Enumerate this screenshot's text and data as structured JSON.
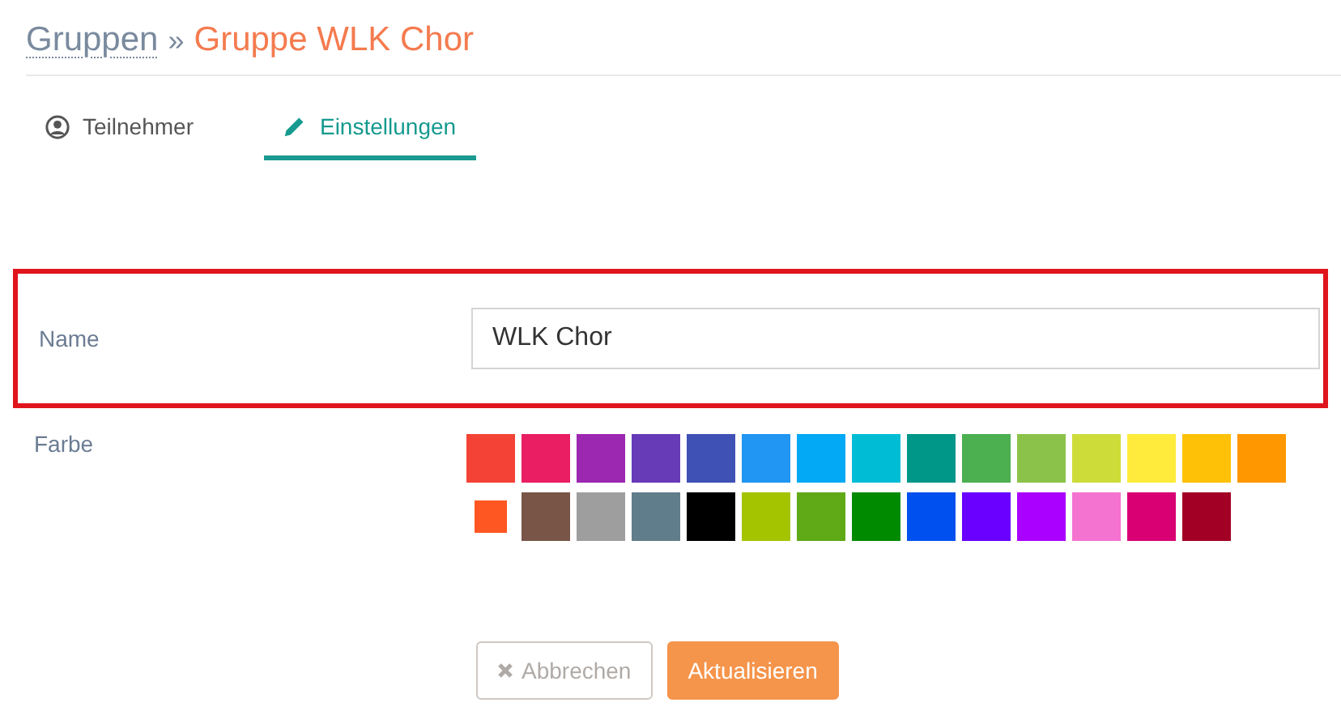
{
  "breadcrumb": {
    "parent": "Gruppen",
    "separator": "»",
    "current": "Gruppe WLK Chor"
  },
  "tabs": [
    {
      "label": "Teilnehmer",
      "kind": "participants",
      "selected": false
    },
    {
      "label": "Einstellungen",
      "kind": "settings",
      "selected": true
    }
  ],
  "form": {
    "name": {
      "label": "Name",
      "value": "WLK Chor",
      "highlighted": true
    },
    "color": {
      "label": "Farbe",
      "swatches": [
        {
          "color": "#f44336",
          "selected": false
        },
        {
          "color": "#e91e63",
          "selected": false
        },
        {
          "color": "#9c27b0",
          "selected": false
        },
        {
          "color": "#673ab7",
          "selected": false
        },
        {
          "color": "#3f51b5",
          "selected": false
        },
        {
          "color": "#2196f3",
          "selected": false
        },
        {
          "color": "#03a9f4",
          "selected": false
        },
        {
          "color": "#00bcd4",
          "selected": false
        },
        {
          "color": "#009688",
          "selected": false
        },
        {
          "color": "#4caf50",
          "selected": false
        },
        {
          "color": "#8bc34a",
          "selected": false
        },
        {
          "color": "#cddc39",
          "selected": false
        },
        {
          "color": "#ffeb3b",
          "selected": false
        },
        {
          "color": "#ffc107",
          "selected": false
        },
        {
          "color": "#ff9800",
          "selected": false
        },
        {
          "color": "#ff5722",
          "selected": true
        },
        {
          "color": "#795548",
          "selected": false
        },
        {
          "color": "#9e9e9e",
          "selected": false
        },
        {
          "color": "#607d8b",
          "selected": false
        },
        {
          "color": "#000000",
          "selected": false
        },
        {
          "color": "#a4c400",
          "selected": false
        },
        {
          "color": "#60a917",
          "selected": false
        },
        {
          "color": "#008a00",
          "selected": false
        },
        {
          "color": "#0050ef",
          "selected": false
        },
        {
          "color": "#6a00ff",
          "selected": false
        },
        {
          "color": "#aa00ff",
          "selected": false
        },
        {
          "color": "#f472d0",
          "selected": false
        },
        {
          "color": "#d80073",
          "selected": false
        },
        {
          "color": "#a20025",
          "selected": false
        }
      ]
    }
  },
  "buttons": [
    {
      "label": "Abbrechen",
      "kind": "cancel"
    },
    {
      "label": "Aktualisieren",
      "kind": "primary"
    }
  ]
}
